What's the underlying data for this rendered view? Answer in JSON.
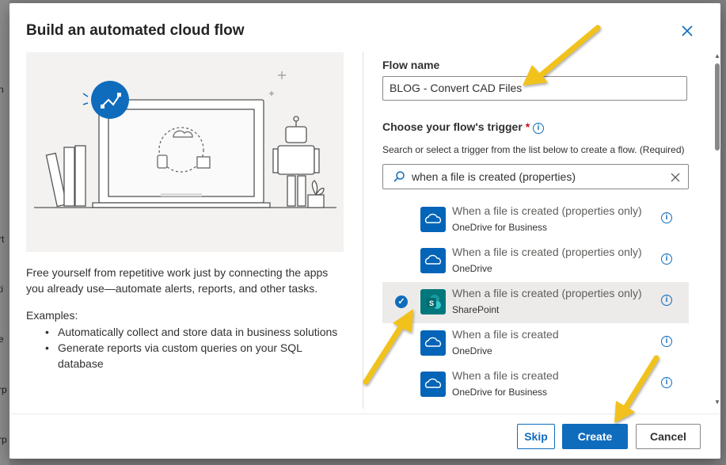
{
  "background": {
    "edge_fragments": [
      "n",
      "rt",
      "ti",
      "e",
      "rp",
      "rp"
    ]
  },
  "dialog": {
    "title": "Build an automated cloud flow",
    "close_icon": "close-icon"
  },
  "left_panel": {
    "description": "Free yourself from repetitive work just by connecting the apps you already use—automate alerts, reports, and other tasks.",
    "examples_label": "Examples:",
    "examples": [
      "Automatically collect and store data in business solutions",
      "Generate reports via custom queries on your SQL database"
    ]
  },
  "right_panel": {
    "flow_name_label": "Flow name",
    "flow_name_value": "BLOG - Convert CAD Files",
    "trigger_label": "Choose your flow's trigger",
    "required_mark": "*",
    "trigger_hint": "Search or select a trigger from the list below to create a flow. (Required)",
    "search_value": "when a file is created (properties)",
    "triggers": [
      {
        "title": "When a file is created (properties only)",
        "connector": "OneDrive for Business",
        "icon": "onedrive-icon",
        "selected": false
      },
      {
        "title": "When a file is created (properties only)",
        "connector": "OneDrive",
        "icon": "onedrive-icon",
        "selected": false
      },
      {
        "title": "When a file is created (properties only)",
        "connector": "SharePoint",
        "icon": "sharepoint-icon",
        "selected": true
      },
      {
        "title": "When a file is created",
        "connector": "OneDrive",
        "icon": "onedrive-icon",
        "selected": false
      },
      {
        "title": "When a file is created",
        "connector": "OneDrive for Business",
        "icon": "onedrive-icon",
        "selected": false
      }
    ]
  },
  "footer": {
    "skip_label": "Skip",
    "create_label": "Create",
    "cancel_label": "Cancel"
  },
  "colors": {
    "accent": "#0f6cbd",
    "onedrive": "#0364b8",
    "sharepoint": "#03787c",
    "annotation_arrow": "#f2c21b"
  }
}
